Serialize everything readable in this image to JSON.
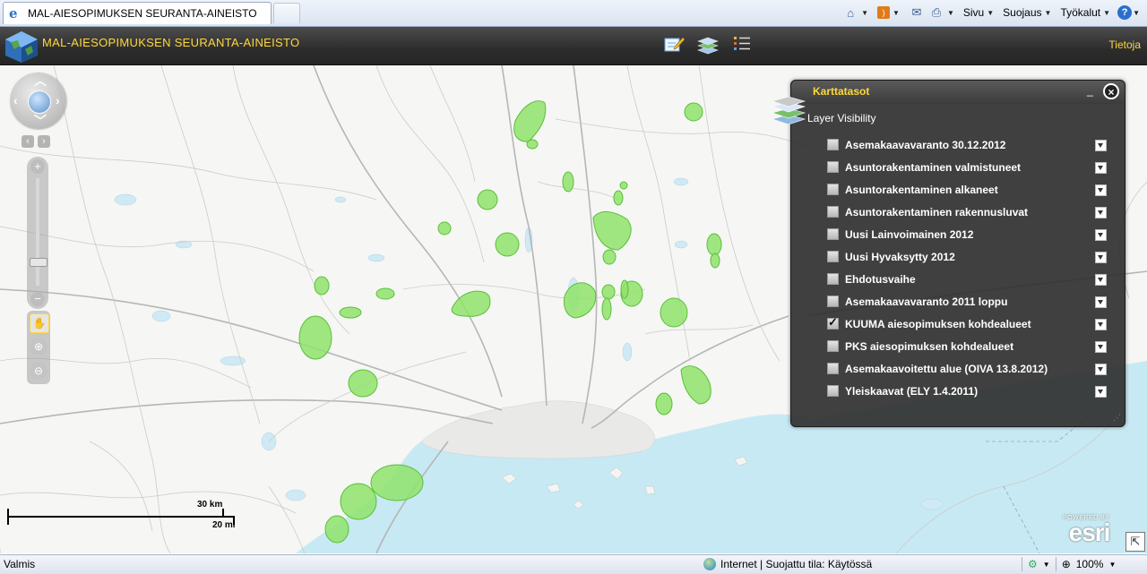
{
  "browser": {
    "tab_title": "MAL-AIESOPIMUKSEN SEURANTA-AINEISTO",
    "command_bar": {
      "page_menu": "Sivu",
      "safety_menu": "Suojaus",
      "tools_menu": "Työkalut",
      "help_label": "?"
    }
  },
  "app": {
    "title": "MAL-AIESOPIMUKSEN SEURANTA-AINEISTO",
    "about_link": "Tietoja",
    "widget_icons": [
      "edit-icon",
      "layers-icon",
      "legend-list-icon"
    ],
    "accent_color": "#ffd83a"
  },
  "map": {
    "scale": {
      "km_label": "30 km",
      "mi_label": "20 mi"
    },
    "esri": {
      "powered": "POWERED BY",
      "brand": "esri"
    },
    "polygon_color": "#8fe36b"
  },
  "layer_panel": {
    "title": "Karttatasot",
    "subtitle": "Layer Visibility",
    "layers": [
      {
        "name": "Asemakaavavaranto 30.12.2012",
        "checked": false
      },
      {
        "name": "Asuntorakentaminen valmistuneet",
        "checked": false
      },
      {
        "name": "Asuntorakentaminen alkaneet",
        "checked": false
      },
      {
        "name": "Asuntorakentaminen rakennusluvat",
        "checked": false
      },
      {
        "name": "Uusi Lainvoimainen 2012",
        "checked": false
      },
      {
        "name": "Uusi Hyvaksytty 2012",
        "checked": false
      },
      {
        "name": "Ehdotusvaihe",
        "checked": false
      },
      {
        "name": "Asemakaavavaranto 2011 loppu",
        "checked": false
      },
      {
        "name": "KUUMA aiesopimuksen kohdealueet",
        "checked": true
      },
      {
        "name": "PKS aiesopimuksen kohdealueet",
        "checked": false
      },
      {
        "name": "Asemakaavoitettu alue (OIVA 13.8.2012)",
        "checked": false
      },
      {
        "name": "Yleiskaavat (ELY 1.4.2011)",
        "checked": false
      }
    ]
  },
  "status": {
    "text": "Valmis",
    "zone": "Internet | Suojattu tila: Käytössä",
    "zoom": "100%"
  }
}
